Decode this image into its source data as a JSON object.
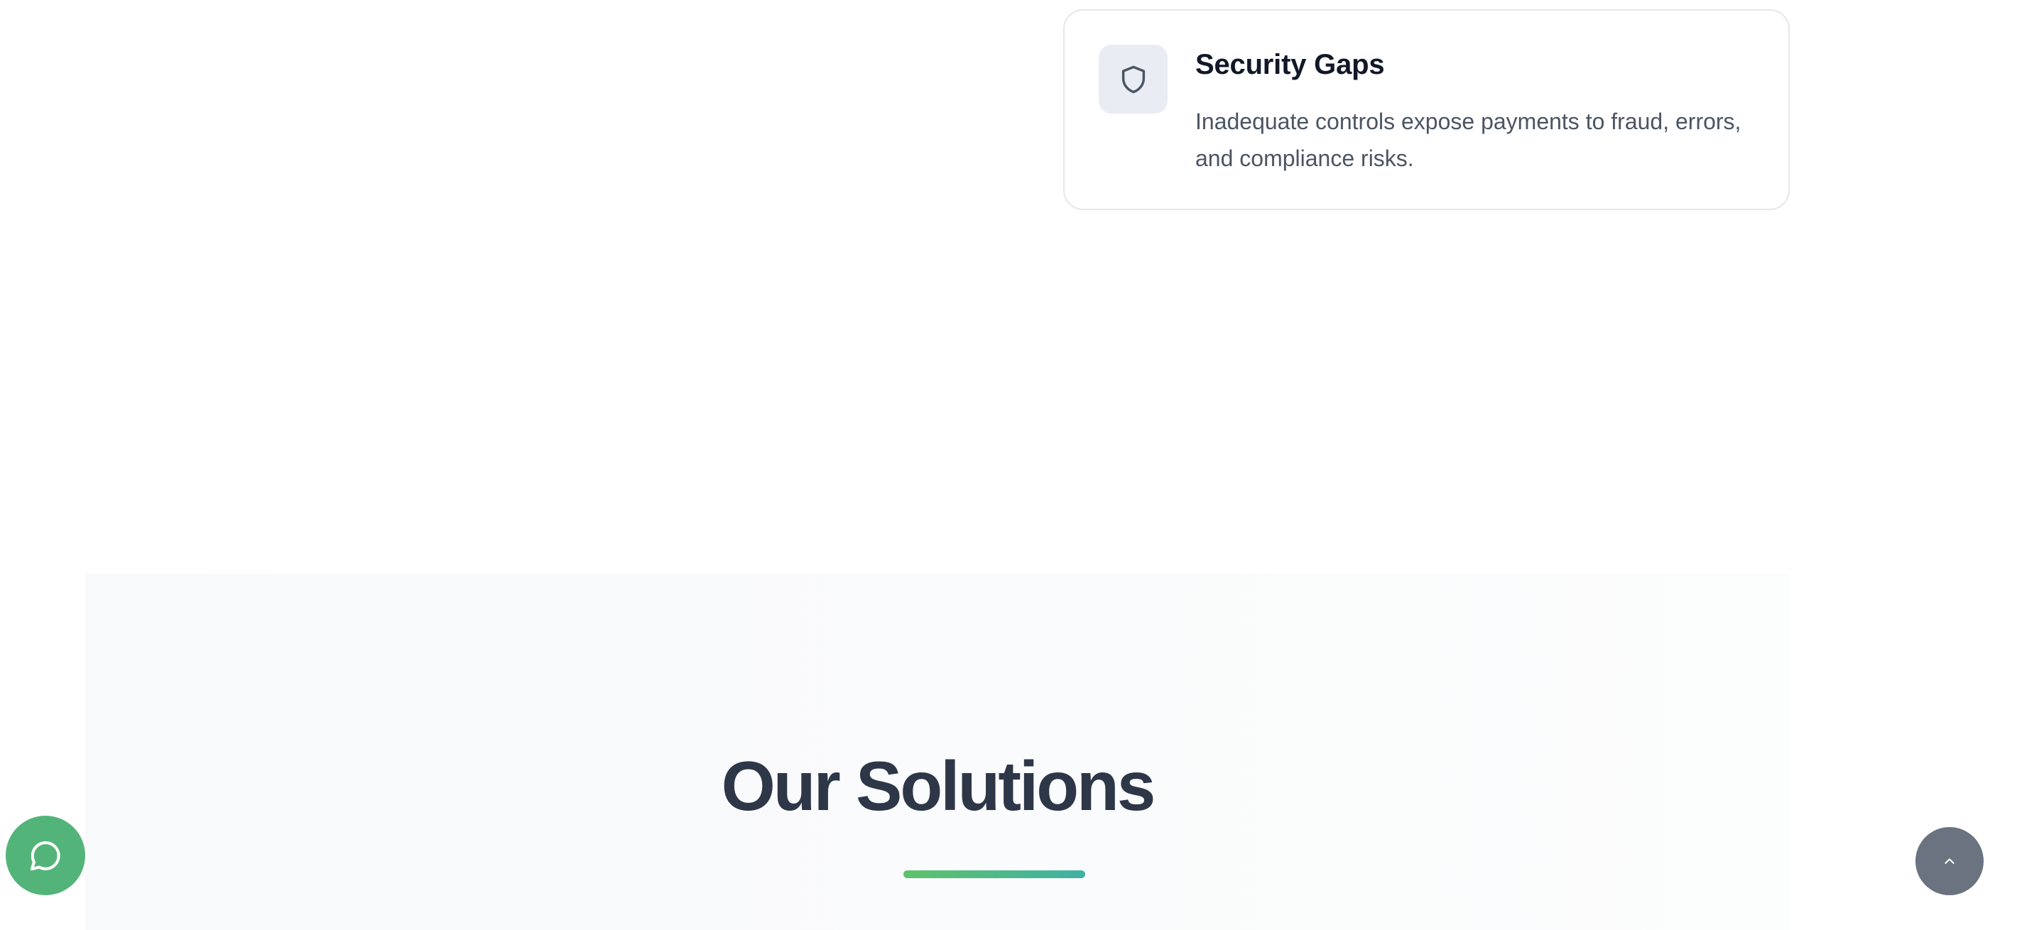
{
  "feature_card": {
    "icon": "shield-icon",
    "title": "Security Gaps",
    "description": "Inadequate controls expose payments to fraud, errors, and compliance risks."
  },
  "solutions": {
    "heading": "Our Solutions",
    "underline_colors": [
      "#5ec26b",
      "#3fb1a4"
    ]
  },
  "floating_buttons": {
    "chat": {
      "icon": "chat-bubble-icon",
      "color": "#53b47a"
    },
    "scroll_top": {
      "icon": "chevron-up-icon",
      "color": "#6b7280"
    }
  },
  "colors": {
    "heading": "#2d3748",
    "card_title": "#111827",
    "card_text": "#4b5563",
    "card_border": "#e5e7eb",
    "icon_tile": "#e9edf3",
    "section_bg": "#f8f9fb"
  }
}
